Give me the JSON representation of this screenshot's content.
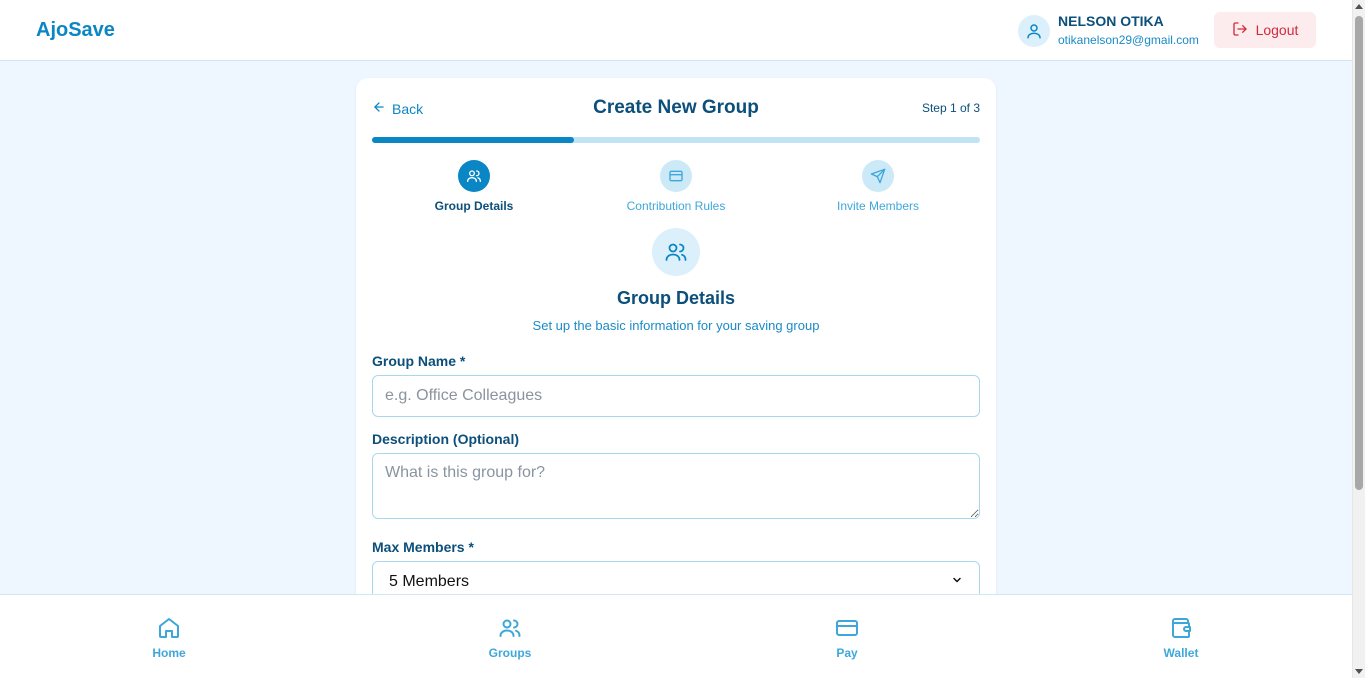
{
  "header": {
    "brand": "AjoSave",
    "user_name": "NELSON OTIKA",
    "user_email": "otikanelson29@gmail.com",
    "logout_label": "Logout"
  },
  "card": {
    "back_label": "Back",
    "title": "Create New Group",
    "step_indicator": "Step 1 of 3",
    "progress": 0.333
  },
  "steps": [
    {
      "label": "Group Details",
      "icon": "users-icon",
      "active": true
    },
    {
      "label": "Contribution Rules",
      "icon": "card-icon",
      "active": false
    },
    {
      "label": "Invite Members",
      "icon": "send-icon",
      "active": false
    }
  ],
  "section": {
    "title": "Group Details",
    "subtitle": "Set up the basic information for your saving group"
  },
  "form": {
    "group_name_label": "Group Name *",
    "group_name_placeholder": "e.g. Office Colleagues",
    "description_label": "Description (Optional)",
    "description_placeholder": "What is this group for?",
    "max_members_label": "Max Members *",
    "max_members_value": "5 Members"
  },
  "nav": [
    {
      "label": "Home",
      "icon": "home-icon"
    },
    {
      "label": "Groups",
      "icon": "users-icon"
    },
    {
      "label": "Pay",
      "icon": "credit-card-icon"
    },
    {
      "label": "Wallet",
      "icon": "wallet-icon"
    }
  ],
  "colors": {
    "primary": "#0a86c4",
    "dark_text": "#0b4f7a",
    "page_bg": "#eef6ff",
    "logout_bg": "#fdecee",
    "logout_text": "#d12b3a"
  }
}
